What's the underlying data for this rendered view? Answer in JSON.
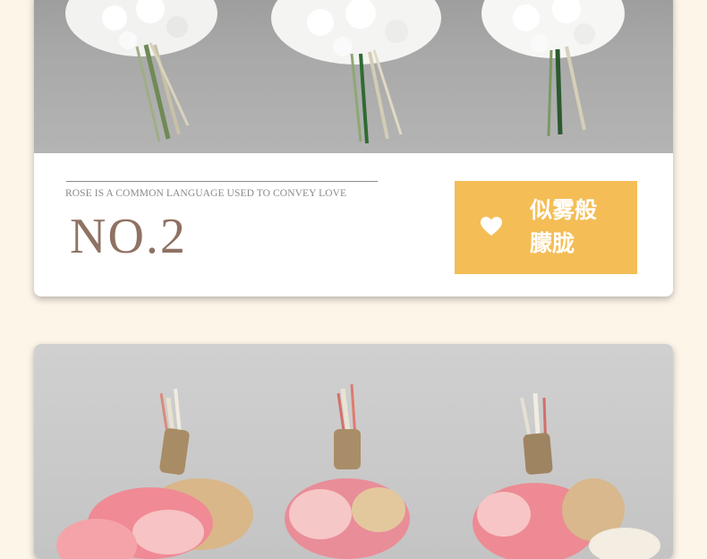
{
  "section_top": {
    "tagline": "ROSE IS A COMMON LANGUAGE USED TO CONVEY LOVE",
    "number": "NO.2",
    "badge": {
      "text_line1": "似雾般",
      "text_line2": "朦胧",
      "icon": "heart-icon",
      "color": "#f4bd55"
    },
    "photo": {
      "subject": "white-hydrangea-bouquets",
      "count": 3
    }
  },
  "section_bottom": {
    "photo": {
      "subject": "pink-dried-flower-bouquets",
      "count": 3
    }
  },
  "colors": {
    "page_background": "#fdf5e8",
    "number_text": "#8f7263",
    "tagline_text": "#8a8a8a"
  }
}
